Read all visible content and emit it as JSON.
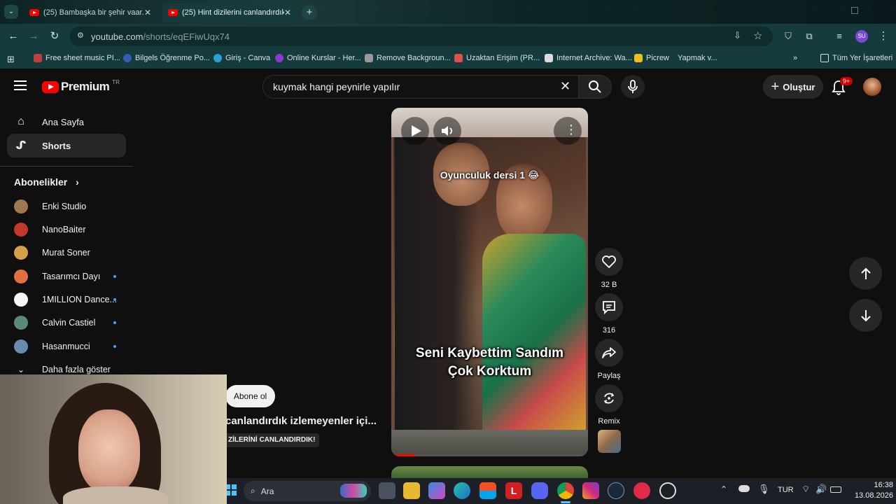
{
  "browser": {
    "tabs": [
      {
        "title": "(25) Bambaşka bir şehir vaar...",
        "active": false
      },
      {
        "title": "(25) Hint dizilerini canlandırdık",
        "active": true
      }
    ],
    "url_host": "youtube.com",
    "url_path": "/shorts/eqEFiwUqx74",
    "profile_initials": "SU",
    "bookmarks": [
      "Free sheet music PI...",
      "Bilgels Öğrenme Po...",
      "Giriş - Canva",
      "Online Kurslar - Her...",
      "Remove Backgroun...",
      "Uzaktan Erişim (PR...",
      "Internet Archive: Wa...",
      "Picrew",
      "Yapmak v..."
    ],
    "all_bookmarks": "Tüm Yer İşaretleri"
  },
  "youtube": {
    "logo_text": "Premium",
    "region": "TR",
    "search_query": "kuymak hangi peynirle yapılır",
    "create_label": "Oluştur",
    "notification_count": "9+",
    "sidebar": {
      "home": "Ana Sayfa",
      "shorts": "Shorts",
      "subscriptions_title": "Abonelikler",
      "subscriptions": [
        {
          "name": "Enki Studio",
          "new": false,
          "color": "#a07850"
        },
        {
          "name": "NanoBaiter",
          "new": false,
          "color": "#c0392b"
        },
        {
          "name": "Murat Soner",
          "new": false,
          "color": "#d4a04a"
        },
        {
          "name": "Tasarımcı Dayı",
          "new": true,
          "color": "#e07040"
        },
        {
          "name": "1MILLION Dance...",
          "new": true,
          "color": "#f5f5f5"
        },
        {
          "name": "Calvin Castiel",
          "new": true,
          "color": "#5a8a7a"
        },
        {
          "name": "Hasanmucci",
          "new": true,
          "color": "#6a8ab0"
        }
      ],
      "show_more": "Daha fazla göster"
    },
    "short": {
      "caption_top": "Oyunculuk dersi 1 😂",
      "caption_main_1": "Seni Kaybettim Sandım",
      "caption_main_2": "Çok Korktum",
      "subscribe_label": "Abone ol",
      "title": "canlandırdık izlemeyenler içi...",
      "tag": "ZİLERİNİ CANLANDIRDIK!",
      "likes": "32 B",
      "comments": "316",
      "share": "Paylaş",
      "remix": "Remix"
    }
  },
  "taskbar": {
    "search_placeholder": "Ara",
    "language": "TUR",
    "time": "16:38",
    "date": "13.08.2026"
  }
}
